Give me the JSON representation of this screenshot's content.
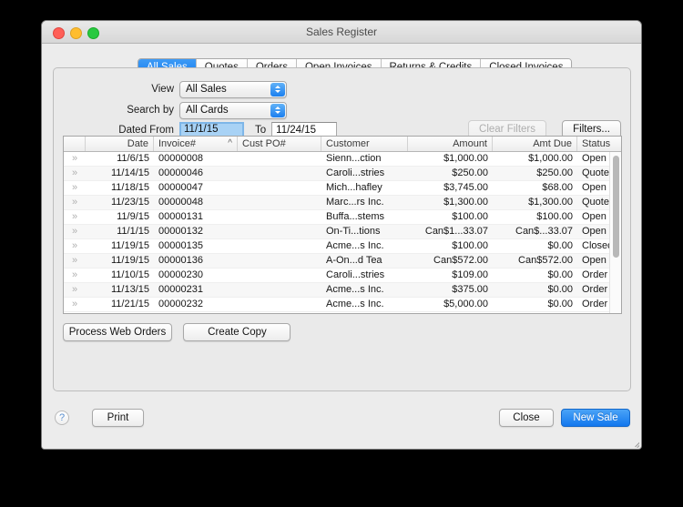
{
  "window": {
    "title": "Sales Register",
    "traffic_lights": [
      "close",
      "minimize",
      "maximize"
    ]
  },
  "tabs": [
    {
      "label": "All Sales",
      "active": true
    },
    {
      "label": "Quotes",
      "active": false
    },
    {
      "label": "Orders",
      "active": false
    },
    {
      "label": "Open Invoices",
      "active": false
    },
    {
      "label": "Returns & Credits",
      "active": false
    },
    {
      "label": "Closed Invoices",
      "active": false
    }
  ],
  "filters": {
    "view_label": "View",
    "view_value": "All Sales",
    "search_by_label": "Search by",
    "search_by_value": "All Cards",
    "dated_from_label": "Dated From",
    "dated_from_value": "11/1/15",
    "to_label": "To",
    "to_value": "11/24/15",
    "clear_filters_label": "Clear Filters",
    "filters_label": "Filters..."
  },
  "table": {
    "columns": [
      {
        "key": "chev",
        "label": ""
      },
      {
        "key": "date",
        "label": "Date"
      },
      {
        "key": "invoice",
        "label": "Invoice#",
        "sorted": "asc",
        "sort_glyph": "^"
      },
      {
        "key": "custpo",
        "label": "Cust PO#"
      },
      {
        "key": "customer",
        "label": "Customer"
      },
      {
        "key": "amount",
        "label": "Amount"
      },
      {
        "key": "amtdue",
        "label": "Amt Due"
      },
      {
        "key": "status",
        "label": "Status"
      }
    ],
    "row_expand_glyph": "»",
    "rows": [
      {
        "date": "11/6/15",
        "invoice": "00000008",
        "custpo": "",
        "customer": "Sienn...ction",
        "amount": "$1,000.00",
        "amtdue": "$1,000.00",
        "status": "Open"
      },
      {
        "date": "11/14/15",
        "invoice": "00000046",
        "custpo": "",
        "customer": "Caroli...stries",
        "amount": "$250.00",
        "amtdue": "$250.00",
        "status": "Quote"
      },
      {
        "date": "11/18/15",
        "invoice": "00000047",
        "custpo": "",
        "customer": "Mich...hafley",
        "amount": "$3,745.00",
        "amtdue": "$68.00",
        "status": "Open"
      },
      {
        "date": "11/23/15",
        "invoice": "00000048",
        "custpo": "",
        "customer": "Marc...rs Inc.",
        "amount": "$1,300.00",
        "amtdue": "$1,300.00",
        "status": "Quote"
      },
      {
        "date": "11/9/15",
        "invoice": "00000131",
        "custpo": "",
        "customer": "Buffa...stems",
        "amount": "$100.00",
        "amtdue": "$100.00",
        "status": "Open"
      },
      {
        "date": "11/1/15",
        "invoice": "00000132",
        "custpo": "",
        "customer": "On-Ti...tions",
        "amount": "Can$1...33.07",
        "amtdue": "Can$...33.07",
        "status": "Open"
      },
      {
        "date": "11/19/15",
        "invoice": "00000135",
        "custpo": "",
        "customer": "Acme...s Inc.",
        "amount": "$100.00",
        "amtdue": "$0.00",
        "status": "Closed"
      },
      {
        "date": "11/19/15",
        "invoice": "00000136",
        "custpo": "",
        "customer": "A-On...d Tea",
        "amount": "Can$572.00",
        "amtdue": "Can$572.00",
        "status": "Open"
      },
      {
        "date": "11/10/15",
        "invoice": "00000230",
        "custpo": "",
        "customer": "Caroli...stries",
        "amount": "$109.00",
        "amtdue": "$0.00",
        "status": "Order"
      },
      {
        "date": "11/13/15",
        "invoice": "00000231",
        "custpo": "",
        "customer": "Acme...s Inc.",
        "amount": "$375.00",
        "amtdue": "$0.00",
        "status": "Order"
      },
      {
        "date": "11/21/15",
        "invoice": "00000232",
        "custpo": "",
        "customer": "Acme...s Inc.",
        "amount": "$5,000.00",
        "amtdue": "$0.00",
        "status": "Order"
      }
    ]
  },
  "panel_actions": {
    "process_web_orders_label": "Process Web Orders",
    "create_copy_label": "Create Copy"
  },
  "footer": {
    "help_label": "?",
    "print_label": "Print",
    "close_label": "Close",
    "new_sale_label": "New Sale"
  },
  "colors": {
    "accent_blue": "#1277ee",
    "selection_blue": "#a8d2f5",
    "window_bg": "#ececec",
    "panel_bg": "#eaeaea",
    "traffic_close": "#ff5f57",
    "traffic_min": "#ffbd2e",
    "traffic_max": "#28c940"
  }
}
